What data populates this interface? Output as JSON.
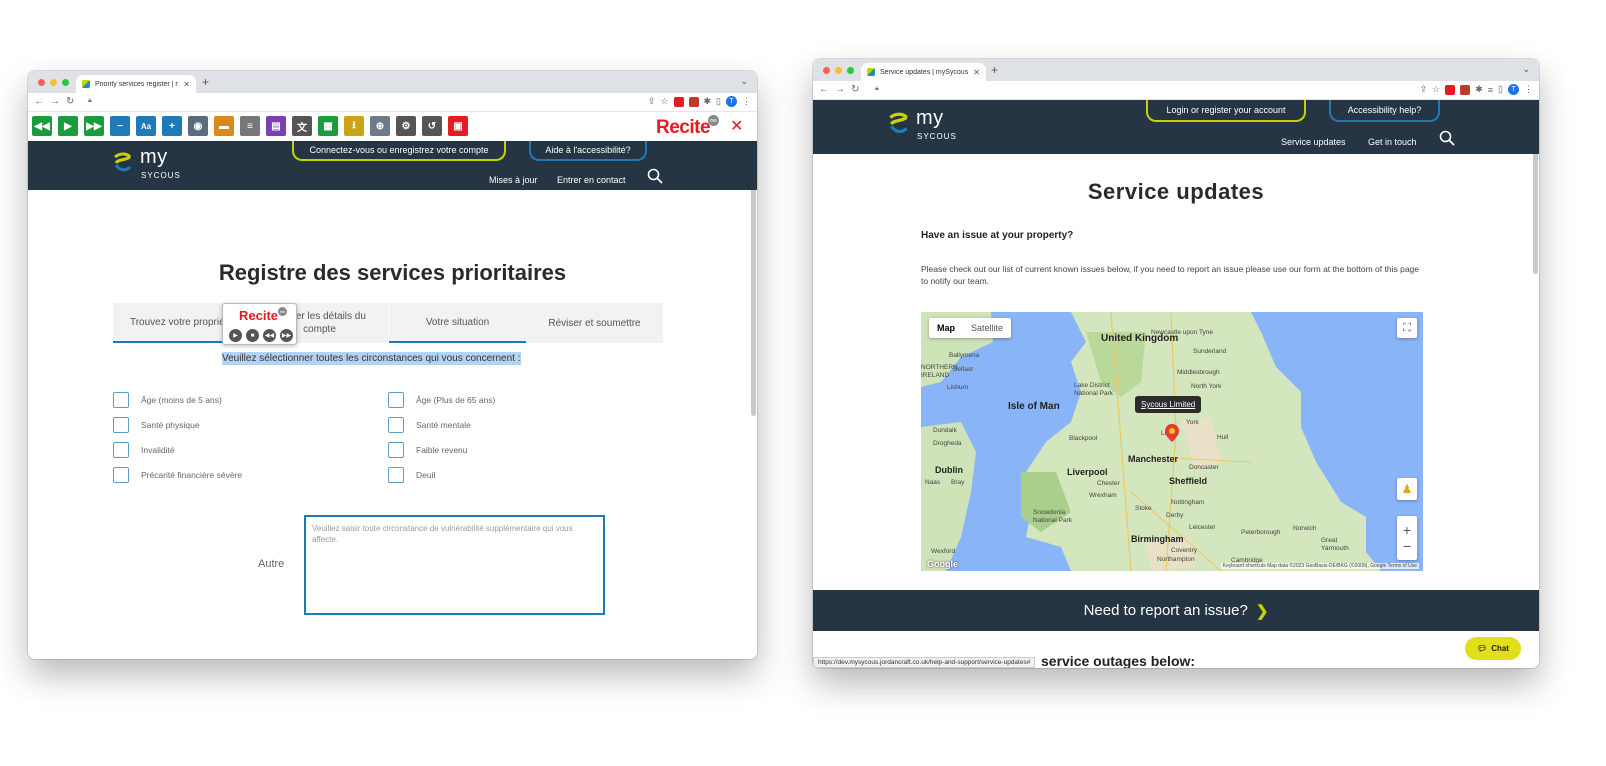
{
  "window1": {
    "tab_title": "Priority services register | myS",
    "recite": {
      "logo": "Recite",
      "badge": "me"
    },
    "header": {
      "logo_word": "my",
      "logo_sub": "SYCOUS",
      "login_button": "Connectez-vous ou enregistrez votre compte",
      "accessibility_button": "Aide à l'accessibilité?",
      "nav": [
        "Mises à jour",
        "Entrer en contact"
      ]
    },
    "page_title": "Registre des services prioritaires",
    "steps": [
      "Trouvez votre propriété",
      "Ajouter les détails du compte",
      "Votre situation",
      "Réviser et soumettre"
    ],
    "speech_popup_logo": "Recite",
    "instruction": "Veuillez sélectionner toutes les circonstances qui vous concernent :",
    "checkboxes_left": [
      "Âge (moins de 5 ans)",
      "Santé physique",
      "Invalidité",
      "Précarité financière sévère"
    ],
    "checkboxes_right": [
      "Âge (Plus de 65 ans)",
      "Santé mentale",
      "Faible revenu",
      "Deuil"
    ],
    "other_label": "Autre",
    "other_placeholder": "Veuillez saisir toute circonstance de vulnérabilité supplémentaire qui vous affecte."
  },
  "window2": {
    "tab_title": "Service updates | mySycous",
    "header": {
      "logo_word": "my",
      "logo_sub": "SYCOUS",
      "login_button": "Login or register your account",
      "accessibility_button": "Accessibility help?",
      "nav": [
        "Service updates",
        "Get in touch"
      ]
    },
    "page_title": "Service updates",
    "subheading": "Have an issue at your property?",
    "paragraph": "Please check out our list of current known issues below, if you need to report an issue please use our form at the bottom of this page to notify our team.",
    "map": {
      "toggle": [
        "Map",
        "Satellite"
      ],
      "popup": "Sycous Limited",
      "labels_big": [
        "United Kingdom",
        "Isle of Man",
        "Manchester",
        "Liverpool",
        "Sheffield",
        "Birmingham",
        "Dublin"
      ],
      "labels_small": [
        "Newcastle upon Tyne",
        "Sunderland",
        "Middlesbrough",
        "Belfast",
        "Lisburn",
        "Lake District National Park",
        "North York",
        "York",
        "Leeds",
        "Hull",
        "Blackpool",
        "Doncaster",
        "Chester",
        "Wrexham",
        "Nottingham",
        "Derby",
        "Stoke",
        "Snowdonia National Park",
        "Leicester",
        "Peterborough",
        "Norwich",
        "Great Yarmouth",
        "Coventry",
        "Northampton",
        "Cambridge",
        "Dundalk",
        "Drogheda",
        "Naas",
        "Bray",
        "Wexford",
        "Ballymena",
        "NORTHERN IRELAND"
      ],
      "footer": "Keyboard shortcuts   Map data ©2023 GeoBasis-DE/BKG (©2009), Google   Terms of Use",
      "google": "Google"
    },
    "banner": "Need to report an issue?",
    "cut_heading": "service outages below:",
    "status_url": "https://dev.mysycous.jordancraft.co.uk/help-and-support/service-updates#",
    "chat": "Chat"
  },
  "colors": {
    "header_bg": "#263543",
    "lime": "#c7d300",
    "blue": "#1e7bb8",
    "recite_red": "#e31b23",
    "recite_green": "#1a9b3d",
    "recite_blue": "#1e7bb8"
  }
}
